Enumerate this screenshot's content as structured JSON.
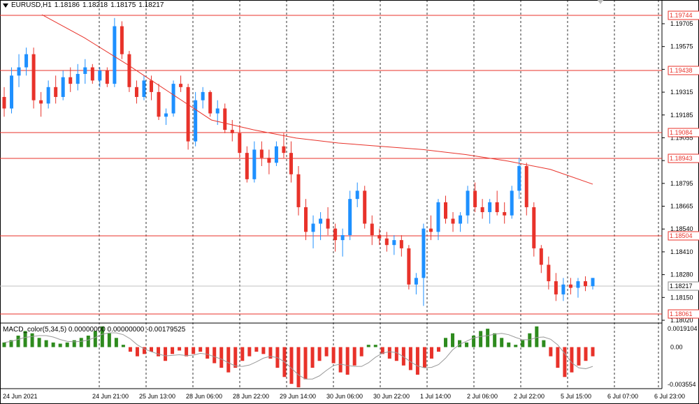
{
  "window": {
    "symbol_label": "EURUSD,H1",
    "ohlc": [
      "1.18186",
      "1.18218",
      "1.18175",
      "1.18217"
    ]
  },
  "macd": {
    "label": "MACD_color(5,34,5) 0.00000000 0.00000000 -0.00179525",
    "max_label": "0.0019104",
    "zero_label": "0.00",
    "min_label": "-0.003554"
  },
  "price_axis": {
    "ticks": [
      "1.19705",
      "1.19575",
      "1.19440",
      "1.19315",
      "1.19185",
      "1.19055",
      "1.18925",
      "1.18795",
      "1.18665",
      "1.18540",
      "1.18410",
      "1.18280",
      "1.18150",
      "1.18020"
    ]
  },
  "level_lines": [
    "1.19744",
    "1.19438",
    "1.19084",
    "1.18943",
    "1.18504",
    "1.18061"
  ],
  "current_price": "1.18217",
  "time_axis": [
    "24 Jun 2021",
    "24 Jun 21:00",
    "25 Jun 13:00",
    "28 Jun 06:00",
    "28 Jun 22:00",
    "29 Jun 14:00",
    "30 Jun 06:00",
    "30 Jun 22:00",
    "1 Jul 14:00",
    "2 Jul 06:00",
    "2 Jul 22:00",
    "5 Jul 15:00",
    "6 Jul 07:00",
    "6 Jul 23:00"
  ],
  "colors": {
    "bull": "#1e90ff",
    "bear": "#e8322a",
    "level": "#e8322a",
    "ma": "#e8322a",
    "macd_pos": "#2e8b1e",
    "macd_neg": "#e8322a"
  },
  "chart_data": {
    "type": "candlestick",
    "timeframe": "H1",
    "y_range": [
      1.1795,
      1.1985
    ],
    "candles": [
      [
        1.1932,
        1.1938,
        1.192,
        1.1925
      ],
      [
        1.1925,
        1.195,
        1.1922,
        1.1945
      ],
      [
        1.1945,
        1.1958,
        1.1938,
        1.195
      ],
      [
        1.195,
        1.1962,
        1.1945,
        1.1958
      ],
      [
        1.1958,
        1.1962,
        1.1925,
        1.193
      ],
      [
        1.193,
        1.1935,
        1.192,
        1.1928
      ],
      [
        1.1928,
        1.1942,
        1.1925,
        1.1938
      ],
      [
        1.1938,
        1.1945,
        1.1928,
        1.1932
      ],
      [
        1.1932,
        1.1948,
        1.193,
        1.1944
      ],
      [
        1.1944,
        1.195,
        1.1935,
        1.194
      ],
      [
        1.194,
        1.1952,
        1.1936,
        1.1946
      ],
      [
        1.1946,
        1.1955,
        1.194,
        1.195
      ],
      [
        1.195,
        1.1952,
        1.194,
        1.1942
      ],
      [
        1.1942,
        1.195,
        1.1938,
        1.1948
      ],
      [
        1.1948,
        1.195,
        1.1938,
        1.194
      ],
      [
        1.194,
        1.198,
        1.1938,
        1.1975
      ],
      [
        1.1975,
        1.1978,
        1.1955,
        1.1958
      ],
      [
        1.1958,
        1.196,
        1.1935,
        1.1938
      ],
      [
        1.1938,
        1.1942,
        1.1928,
        1.1932
      ],
      [
        1.1932,
        1.1945,
        1.193,
        1.1942
      ],
      [
        1.1942,
        1.1945,
        1.193,
        1.1935
      ],
      [
        1.1935,
        1.194,
        1.1918,
        1.192
      ],
      [
        1.192,
        1.1925,
        1.1915,
        1.1922
      ],
      [
        1.1922,
        1.1942,
        1.192,
        1.194
      ],
      [
        1.194,
        1.1945,
        1.1935,
        1.1938
      ],
      [
        1.1938,
        1.194,
        1.19,
        1.1905
      ],
      [
        1.1905,
        1.1935,
        1.1902,
        1.193
      ],
      [
        1.193,
        1.1938,
        1.1925,
        1.1935
      ],
      [
        1.1935,
        1.1936,
        1.192,
        1.1922
      ],
      [
        1.1922,
        1.193,
        1.1915,
        1.1925
      ],
      [
        1.1925,
        1.1928,
        1.191,
        1.1912
      ],
      [
        1.1912,
        1.1918,
        1.1905,
        1.191
      ],
      [
        1.191,
        1.1915,
        1.1895,
        1.1898
      ],
      [
        1.1898,
        1.1902,
        1.188,
        1.1882
      ],
      [
        1.1882,
        1.1905,
        1.188,
        1.19
      ],
      [
        1.19,
        1.1905,
        1.189,
        1.1895
      ],
      [
        1.1895,
        1.19,
        1.1885,
        1.1892
      ],
      [
        1.1892,
        1.1905,
        1.189,
        1.1902
      ],
      [
        1.1902,
        1.191,
        1.1895,
        1.1898
      ],
      [
        1.1898,
        1.1905,
        1.188,
        1.1885
      ],
      [
        1.1885,
        1.189,
        1.186,
        1.1865
      ],
      [
        1.1865,
        1.187,
        1.1845,
        1.185
      ],
      [
        1.185,
        1.186,
        1.184,
        1.1855
      ],
      [
        1.1855,
        1.1862,
        1.1845,
        1.1858
      ],
      [
        1.1858,
        1.1865,
        1.1848,
        1.1852
      ],
      [
        1.1852,
        1.1855,
        1.1838,
        1.1845
      ],
      [
        1.1845,
        1.1852,
        1.1835,
        1.1848
      ],
      [
        1.1848,
        1.1875,
        1.1845,
        1.187
      ],
      [
        1.187,
        1.188,
        1.1865,
        1.1875
      ],
      [
        1.1875,
        1.1878,
        1.1852,
        1.1855
      ],
      [
        1.1855,
        1.186,
        1.1842,
        1.1848
      ],
      [
        1.1848,
        1.1852,
        1.1842,
        1.1846
      ],
      [
        1.1846,
        1.185,
        1.1838,
        1.1842
      ],
      [
        1.1842,
        1.1848,
        1.1836,
        1.1845
      ],
      [
        1.1845,
        1.1848,
        1.1835,
        1.184
      ],
      [
        1.184,
        1.1842,
        1.1815,
        1.1818
      ],
      [
        1.1818,
        1.1825,
        1.1812,
        1.1822
      ],
      [
        1.1822,
        1.1855,
        1.1805,
        1.1852
      ],
      [
        1.1852,
        1.186,
        1.1845,
        1.185
      ],
      [
        1.185,
        1.187,
        1.1845,
        1.1868
      ],
      [
        1.1868,
        1.1872,
        1.1855,
        1.1858
      ],
      [
        1.1858,
        1.1862,
        1.185,
        1.1855
      ],
      [
        1.1855,
        1.1862,
        1.185,
        1.186
      ],
      [
        1.186,
        1.1878,
        1.1855,
        1.1875
      ],
      [
        1.1875,
        1.188,
        1.1862,
        1.1865
      ],
      [
        1.1865,
        1.187,
        1.1858,
        1.1862
      ],
      [
        1.1862,
        1.187,
        1.1855,
        1.1868
      ],
      [
        1.1868,
        1.1875,
        1.186,
        1.1862
      ],
      [
        1.1862,
        1.1868,
        1.1855,
        1.186
      ],
      [
        1.186,
        1.1878,
        1.1858,
        1.1875
      ],
      [
        1.1875,
        1.1895,
        1.187,
        1.189
      ],
      [
        1.189,
        1.1892,
        1.186,
        1.1865
      ],
      [
        1.1865,
        1.1868,
        1.1835,
        1.184
      ],
      [
        1.184,
        1.1842,
        1.1825,
        1.183
      ],
      [
        1.183,
        1.1835,
        1.1815,
        1.182
      ],
      [
        1.182,
        1.1825,
        1.1808,
        1.1812
      ],
      [
        1.1812,
        1.1822,
        1.1808,
        1.1818
      ],
      [
        1.1818,
        1.1822,
        1.1812,
        1.1816
      ],
      [
        1.1816,
        1.1822,
        1.181,
        1.182
      ],
      [
        1.182,
        1.1823,
        1.1814,
        1.1817
      ],
      [
        1.1817,
        1.1822,
        1.1815,
        1.1822
      ]
    ],
    "moving_average": [
      1.1982,
      1.1968,
      1.1952,
      1.1935,
      1.1918,
      1.1912,
      1.1907,
      1.1904,
      1.1902,
      1.19,
      1.1897,
      1.1893,
      1.1888,
      1.1879
    ],
    "macd_histogram": [
      0.0004,
      0.0006,
      0.001,
      0.0014,
      0.0012,
      0.0008,
      0.0006,
      0.0004,
      0.0003,
      0.0004,
      0.0006,
      0.0008,
      0.001,
      0.0014,
      0.0018,
      0.0012,
      0.0008,
      0.0002,
      -0.0004,
      -0.0008,
      -0.0006,
      -0.0004,
      -0.0008,
      -0.0012,
      -0.0006,
      -0.0003,
      -0.0008,
      -0.0006,
      -0.0004,
      -0.001,
      -0.0014,
      -0.0018,
      -0.0022,
      -0.0018,
      -0.0012,
      -0.0008,
      -0.0004,
      -0.0006,
      -0.001,
      -0.0018,
      -0.0026,
      -0.0032,
      -0.0035,
      -0.0028,
      -0.0018,
      -0.0012,
      -0.0008,
      -0.0014,
      -0.0022,
      -0.0024,
      -0.0016,
      -0.0008,
      0.0002,
      0.0002,
      -0.0006,
      -0.001,
      -0.0012,
      -0.0016,
      -0.002,
      -0.0024,
      -0.0018,
      -0.001,
      -0.0004,
      0.0008,
      0.0012,
      0.0006,
      0.0004,
      0.001,
      0.0014,
      0.0016,
      0.0012,
      0.0008,
      0.0004,
      0.0002,
      0.0006,
      0.0012,
      0.0018,
      0.0006,
      -0.0008,
      -0.0018,
      -0.0026,
      -0.0022,
      -0.0016,
      -0.0012,
      -0.0008
    ],
    "macd_ylim": [
      -0.003554,
      0.0019104
    ]
  }
}
